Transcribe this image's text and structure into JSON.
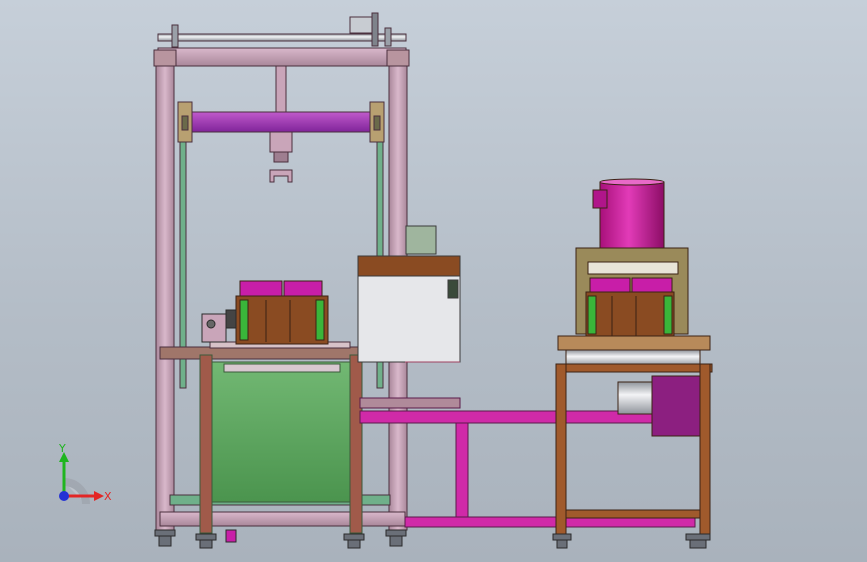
{
  "view": {
    "background_top": "#c6cfd9",
    "background_bottom": "#a9b2bc"
  },
  "triad": {
    "x_label": "X",
    "y_label": "Y",
    "x_color": "#e32626",
    "y_color": "#1fb51f",
    "z_color": "#2432d4"
  },
  "colors": {
    "frame": "#c9a5b9",
    "frame_edge": "#5a3a4a",
    "beam_purple": "#a040b0",
    "magenta": "#d01aa0",
    "rail_green": "#6fb08a",
    "brown": "#8a4b22",
    "table_brown": "#a05a2c",
    "green_panel": "#5aa85c",
    "olive": "#9a8a5a",
    "steel": "#d8dbe0"
  }
}
